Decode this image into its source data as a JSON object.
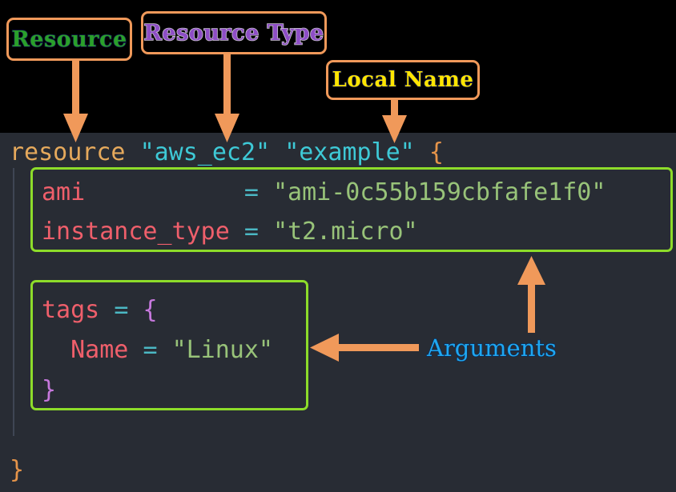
{
  "title": "Terraform resource block annotated diagram",
  "theme": {
    "annotation_band_bg": "#000000",
    "code_bg": "#282c34",
    "chip_border": "#f0995a",
    "arrow_color": "#f0995a",
    "highlight_box_border": "#8ddc2a",
    "indent_guide": "#3f4654"
  },
  "annotations": {
    "resource": {
      "label": "Resource",
      "text_color": "#2aa02a",
      "outline_color": "#101a4a"
    },
    "resource_type": {
      "label": "Resource Type",
      "text_color": "#8e4ec6",
      "outline_color": "#c9c4cf"
    },
    "local_name": {
      "label": "Local Name",
      "text_color": "#ffe500",
      "outline_color": "#101a4a"
    },
    "arguments": {
      "label": "Arguments",
      "text_color": "#1fa7f0",
      "outline_color": "#0c2a54"
    }
  },
  "code": {
    "language": "hcl",
    "header": {
      "keyword": "resource",
      "gap1": " ",
      "resource_type": "\"aws_ec2\"",
      "gap2": " ",
      "local_name": "\"example\"",
      "gap3": " ",
      "open_brace": "{"
    },
    "arguments_block": [
      {
        "name": "ami",
        "pad": "           ",
        "equals": "=",
        "gap": " ",
        "value": "\"ami-0c55b159cbfafe1f0\""
      },
      {
        "name": "instance_type",
        "pad": " ",
        "equals": "=",
        "gap": " ",
        "value": "\"t2.micro\""
      }
    ],
    "tags_block": {
      "open": {
        "name": "tags",
        "gap1": " ",
        "equals": "=",
        "gap2": " ",
        "brace": "{"
      },
      "entry": {
        "indent": "  ",
        "name": "Name",
        "gap1": " ",
        "equals": "=",
        "gap2": " ",
        "value": "\"Linux\""
      },
      "close_brace": "}"
    },
    "close_brace": "}",
    "token_colors": {
      "keyword": "#e5a95c",
      "header_string": "#3ec9d6",
      "brace_orange": "#e5944a",
      "attribute": "#ef5f6b",
      "equals": "#4bb8c4",
      "string": "#98c379",
      "brace_purple": "#c678dd"
    }
  }
}
